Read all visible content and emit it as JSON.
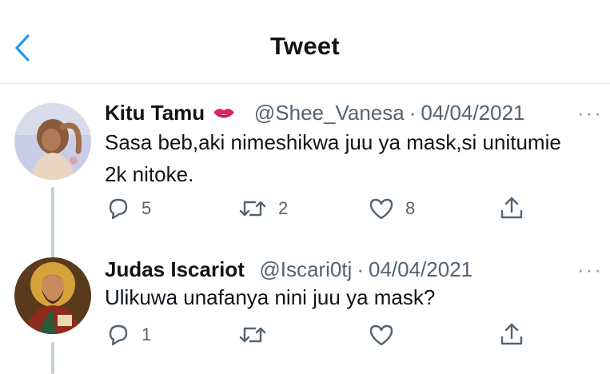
{
  "header": {
    "title": "Tweet"
  },
  "tweets": [
    {
      "name": "Kitu Tamu",
      "handle": "@Shee_Vanesa",
      "separator": "·",
      "date": "04/04/2021",
      "text_line1": "Sasa beb,aki nimeshikwa juu ya mask,si unitumie",
      "text_line2": "2k nitoke.",
      "replies": "5",
      "retweets": "2",
      "likes": "8"
    },
    {
      "name": "Judas Iscariot",
      "handle": "@Iscari0tj",
      "separator": "·",
      "date": "04/04/2021",
      "text_line1": "Ulikuwa unafanya nini juu ya mask?",
      "replies": "1"
    }
  ],
  "more_label": "···",
  "colors": {
    "accent": "#1d9bf0",
    "icon": "#536471",
    "divider": "#e1e8ed"
  },
  "icons": [
    "back-arrow-icon",
    "lips-emoji-icon",
    "reply-icon",
    "retweet-icon",
    "like-icon",
    "share-icon",
    "more-icon"
  ]
}
